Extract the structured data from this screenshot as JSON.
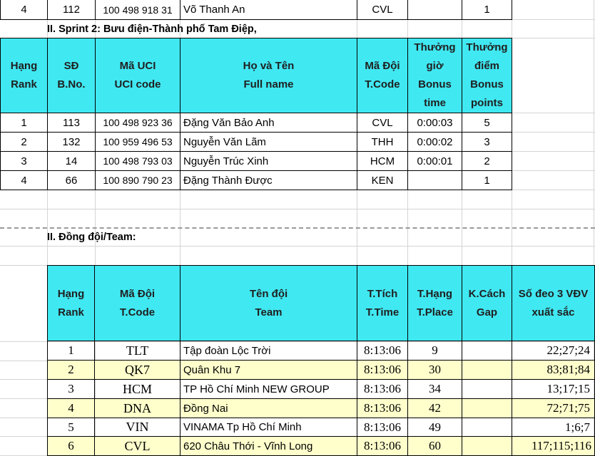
{
  "top_row": {
    "rank": "4",
    "bno": "112",
    "uci": "100 498 918 31",
    "name": "Võ Thanh An",
    "code": "CVL",
    "time": "",
    "points": "1"
  },
  "sprint2": {
    "title": "II. Sprint 2: Bưu điện-Thành phố Tam Điệp,",
    "headers": {
      "rank": [
        "Hạng",
        "Rank"
      ],
      "bno": [
        "SĐ",
        "B.No."
      ],
      "uci": [
        "Mã UCI",
        "UCI code"
      ],
      "name": [
        "Họ và Tên",
        "Full name"
      ],
      "code": [
        "Mã Đội",
        "T.Code"
      ],
      "time": [
        "Thưởng",
        "giờ",
        "Bonus",
        "time"
      ],
      "points": [
        "Thưởng",
        "điểm",
        "Bonus",
        "points"
      ]
    },
    "rows": [
      {
        "rank": "1",
        "bno": "113",
        "uci": "100 498 923 36",
        "name": "Đặng Văn Bảo Anh",
        "code": "CVL",
        "time": "0:00:03",
        "points": "5"
      },
      {
        "rank": "2",
        "bno": "132",
        "uci": "100 959 496 53",
        "name": "Nguyễn Văn Lãm",
        "code": "THH",
        "time": "0:00:02",
        "points": "3"
      },
      {
        "rank": "3",
        "bno": "14",
        "uci": "100 498 793 03",
        "name": "Nguyễn Trúc Xinh",
        "code": "HCM",
        "time": "0:00:01",
        "points": "2"
      },
      {
        "rank": "4",
        "bno": "66",
        "uci": "100 890 790 23",
        "name": "Đặng Thành Được",
        "code": "KEN",
        "time": "",
        "points": "1"
      }
    ]
  },
  "team": {
    "title": "II. Đồng đội/Team:",
    "headers": {
      "rank": [
        "Hạng",
        "Rank"
      ],
      "code": [
        "Mã Đội",
        "T.Code"
      ],
      "team": [
        "Tên đội",
        "Team"
      ],
      "time": [
        "T.Tích",
        "T.Time"
      ],
      "place": [
        "T.Hạng",
        "T.Place"
      ],
      "gap": [
        "K.Cách",
        "Gap"
      ],
      "top3": [
        "Số đeo 3 VĐV",
        "xuất sắc"
      ]
    },
    "rows": [
      {
        "rank": "1",
        "code": "TLT",
        "team": "Tập đoàn Lộc Trời",
        "time": "8:13:06",
        "place": "9",
        "gap": "",
        "top3": "22;27;24"
      },
      {
        "rank": "2",
        "code": "QK7",
        "team": "Quân Khu 7",
        "time": "8:13:06",
        "place": "30",
        "gap": "",
        "top3": "83;81;84"
      },
      {
        "rank": "3",
        "code": "HCM",
        "team": "TP Hồ Chí Minh NEW GROUP",
        "time": "8:13:06",
        "place": "34",
        "gap": "",
        "top3": "13;17;15"
      },
      {
        "rank": "4",
        "code": "DNA",
        "team": "Đồng Nai",
        "time": "8:13:06",
        "place": "42",
        "gap": "",
        "top3": "72;71;75"
      },
      {
        "rank": "5",
        "code": "VIN",
        "team": "VINAMA Tp Hồ Chí Minh",
        "time": "8:13:06",
        "place": "49",
        "gap": "",
        "top3": "1;6;7"
      },
      {
        "rank": "6",
        "code": "CVL",
        "team": "620 Châu Thới - Vĩnh Long",
        "time": "8:13:06",
        "place": "60",
        "gap": "",
        "top3": "117;115;116"
      }
    ]
  }
}
